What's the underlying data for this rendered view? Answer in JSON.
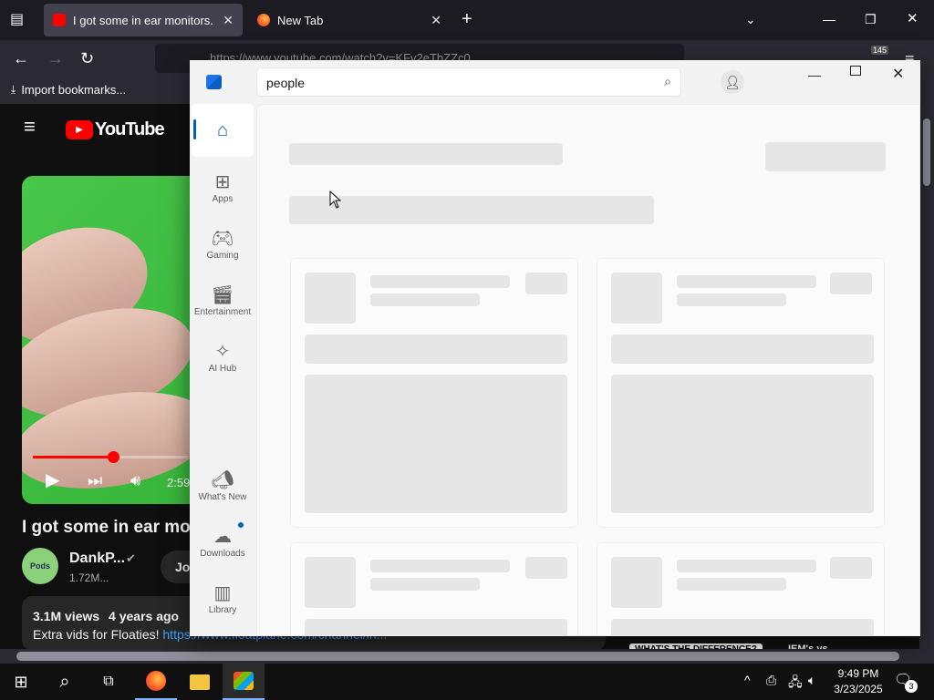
{
  "firefox": {
    "tabs": [
      {
        "title": "I got some in ear monitors. - Yo",
        "active": true
      },
      {
        "title": "New Tab",
        "active": false
      }
    ],
    "url": "https://www.youtube.com/watch?v=KFv2eTbZZc0",
    "bookmarks": {
      "import_label": "Import bookmarks..."
    },
    "extension_badge": "145"
  },
  "youtube": {
    "logo_text": "YouTube",
    "time_label": "2:59",
    "video_title": "I got some in ear mo",
    "channel_name": "DankP...",
    "subscribers": "1.72M...",
    "join_label": "Jo",
    "views": "3.1M views",
    "age": "4 years ago",
    "description_text": "Extra vids for Floaties! ",
    "description_link": "https://www.floatplane.com/channel/ln...",
    "bottom_chip": "WHAT'S THE DIFFERENCE?",
    "bottom_chip2": "IEM's vs"
  },
  "store": {
    "search_value": "people",
    "nav": [
      {
        "label": "",
        "icon": "home-icon"
      },
      {
        "label": "Apps",
        "icon": "apps-icon"
      },
      {
        "label": "Gaming",
        "icon": "gamepad-icon"
      },
      {
        "label": "Entertainment",
        "icon": "clapper-icon"
      },
      {
        "label": "AI Hub",
        "icon": "sparkle-icon"
      },
      {
        "label": "What's New",
        "icon": "megaphone-icon"
      },
      {
        "label": "Downloads",
        "icon": "download-icon"
      },
      {
        "label": "Library",
        "icon": "library-icon"
      }
    ]
  },
  "taskbar": {
    "time": "9:49 PM",
    "date": "3/23/2025",
    "notification_count": "3"
  }
}
